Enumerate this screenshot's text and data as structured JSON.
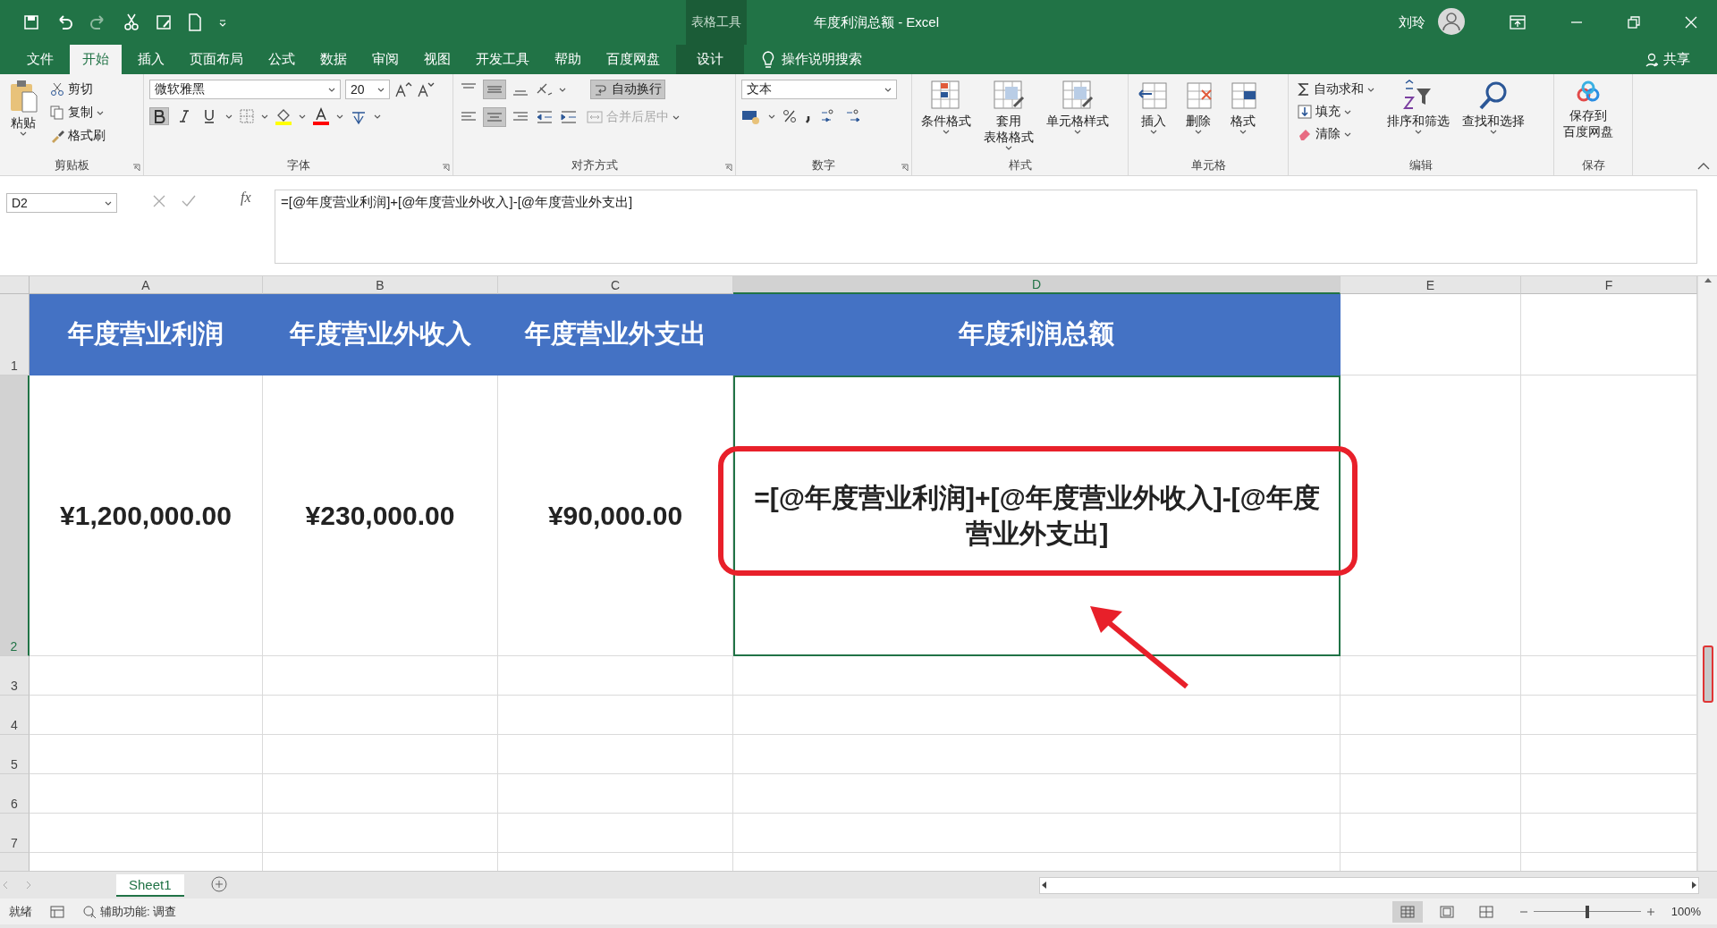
{
  "title_bar": {
    "context_label": "表格工具",
    "title": "年度利润总额 - Excel",
    "user": "刘玲"
  },
  "tabs": [
    {
      "label": "文件",
      "selected": false,
      "kind": "normal"
    },
    {
      "label": "开始",
      "selected": true,
      "kind": "normal"
    },
    {
      "label": "插入",
      "selected": false,
      "kind": "normal"
    },
    {
      "label": "页面布局",
      "selected": false,
      "kind": "normal"
    },
    {
      "label": "公式",
      "selected": false,
      "kind": "normal"
    },
    {
      "label": "数据",
      "selected": false,
      "kind": "normal"
    },
    {
      "label": "审阅",
      "selected": false,
      "kind": "normal"
    },
    {
      "label": "视图",
      "selected": false,
      "kind": "normal"
    },
    {
      "label": "开发工具",
      "selected": false,
      "kind": "normal"
    },
    {
      "label": "帮助",
      "selected": false,
      "kind": "normal"
    },
    {
      "label": "百度网盘",
      "selected": false,
      "kind": "normal"
    },
    {
      "label": "设计",
      "selected": false,
      "kind": "contextual"
    }
  ],
  "search": {
    "label": "操作说明搜索"
  },
  "share": "共享",
  "ribbon": {
    "clipboard": {
      "label": "剪贴板",
      "paste": "粘贴",
      "cut": "剪切",
      "copy": "复制",
      "format_painter": "格式刷"
    },
    "font": {
      "label": "字体",
      "family": "微软雅黑",
      "size": "20",
      "bold": true,
      "italic": false,
      "underline": false
    },
    "alignment": {
      "label": "对齐方式",
      "middle_align": true,
      "center_align": true,
      "wrap_text": {
        "label": "自动换行",
        "on": true
      },
      "merge": {
        "label": "合并后居中",
        "disabled": true
      }
    },
    "number": {
      "label": "数字",
      "format": "文本"
    },
    "styles": {
      "label": "样式",
      "buttons": [
        {
          "lines": [
            "条件格式"
          ]
        },
        {
          "lines": [
            "套用",
            "表格格式"
          ]
        },
        {
          "lines": [
            "单元格样式"
          ]
        }
      ]
    },
    "cells": {
      "label": "单元格",
      "buttons": [
        "插入",
        "删除",
        "格式"
      ]
    },
    "editing": {
      "label": "编辑",
      "autosum": "自动求和",
      "fill": "填充",
      "clear": "清除",
      "sort": "排序和筛选",
      "find": "查找和选择"
    },
    "save": {
      "label": "保存",
      "lines": [
        "保存到",
        "百度网盘"
      ]
    }
  },
  "formula_bar": {
    "name_box": "D2",
    "fx": "fx",
    "formula": "=[@年度营业利润]+[@年度营业外收入]-[@年度营业外支出]"
  },
  "sheet": {
    "columns": [
      {
        "label": "A",
        "selected": false
      },
      {
        "label": "B",
        "selected": false
      },
      {
        "label": "C",
        "selected": false
      },
      {
        "label": "D",
        "selected": true
      },
      {
        "label": "E",
        "selected": false
      },
      {
        "label": "F",
        "selected": false
      }
    ],
    "rows": [
      {
        "label": "1",
        "selected": false
      },
      {
        "label": "2",
        "selected": true
      },
      {
        "label": "3",
        "selected": false
      },
      {
        "label": "4",
        "selected": false
      },
      {
        "label": "5",
        "selected": false
      },
      {
        "label": "6",
        "selected": false
      },
      {
        "label": "7",
        "selected": false
      }
    ],
    "header_row": [
      "年度营业利润",
      "年度营业外收入",
      "年度营业外支出",
      "年度利润总额"
    ],
    "data_row": [
      "¥1,200,000.00",
      "¥230,000.00",
      "¥90,000.00",
      "=[@年度营业利润]+[@年度营业外收入]-[@年度营业外支出]"
    ]
  },
  "sheet_tabs": [
    {
      "label": "Sheet1",
      "selected": true
    }
  ],
  "status_bar": {
    "status": "就绪",
    "accessibility": "辅助功能: 调查",
    "views": [
      {
        "selected": true
      },
      {
        "selected": false
      },
      {
        "selected": false
      }
    ],
    "zoom_slider": {
      "level": 0.5
    },
    "zoom": "100%"
  }
}
